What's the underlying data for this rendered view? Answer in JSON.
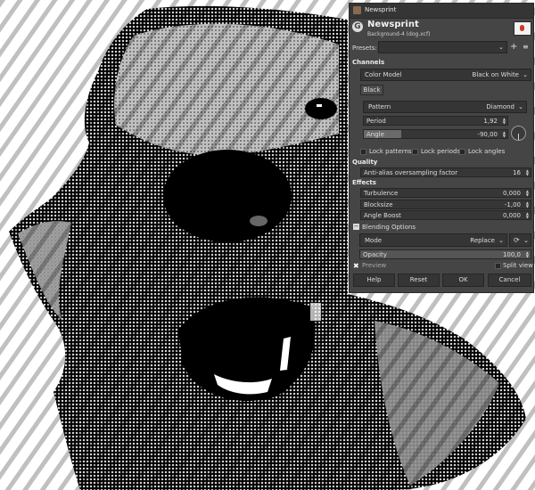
{
  "dialog": {
    "window_title": "Newsprint",
    "title": "Newsprint",
    "subtitle": "Background-4 (dog.xcf)",
    "logo_letter": "G",
    "presets": {
      "label": "Presets:",
      "value": "",
      "add_icon": "+",
      "menu_icon": "≡"
    },
    "channels": {
      "heading": "Channels",
      "color_model": {
        "label": "Color Model",
        "value": "Black on White"
      },
      "tab": "Black",
      "pattern": {
        "label": "Pattern",
        "value": "Diamond"
      },
      "period": {
        "label": "Period",
        "value": "1,92"
      },
      "angle": {
        "label": "Angle",
        "value": "-90,00"
      },
      "lock_patterns": "Lock patterns",
      "lock_periods": "Lock periods",
      "lock_angles": "Lock angles"
    },
    "quality": {
      "heading": "Quality",
      "aa": {
        "label": "Anti-alias oversampling factor",
        "value": "16"
      }
    },
    "effects": {
      "heading": "Effects",
      "turbulence": {
        "label": "Turbulence",
        "value": "0,000"
      },
      "blocksize": {
        "label": "Blocksize",
        "value": "-1,00"
      },
      "angle_boost": {
        "label": "Angle Boost",
        "value": "0,000"
      }
    },
    "blending": {
      "heading": "Blending Options",
      "toggle": "−",
      "mode": {
        "label": "Mode",
        "value": "Replace"
      },
      "opacity": {
        "label": "Opacity",
        "value": "100,0"
      }
    },
    "preview": {
      "label": "Preview",
      "checked": true
    },
    "split_view": "Split view",
    "buttons": {
      "help": "Help",
      "reset": "Reset",
      "ok": "OK",
      "cancel": "Cancel"
    }
  },
  "colors": {
    "dialog_bg": "#454545",
    "field_bg": "#363636",
    "text": "#dcdcdc"
  }
}
